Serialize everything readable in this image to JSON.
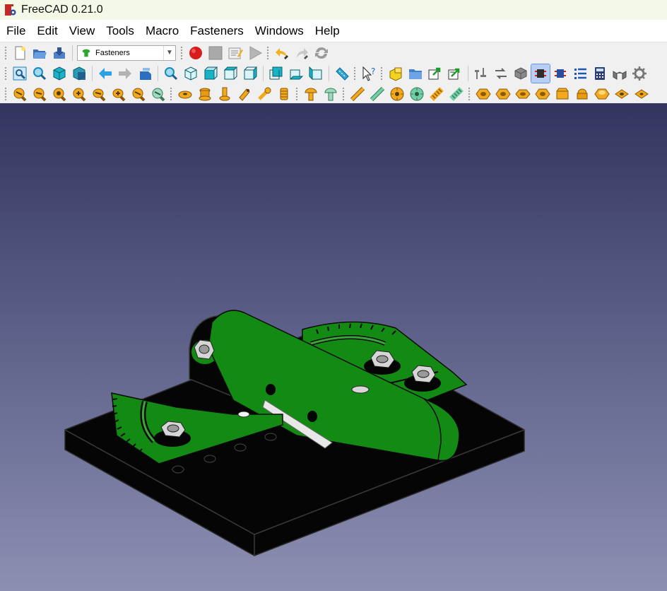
{
  "window": {
    "title": "FreeCAD 0.21.0",
    "logo_icon": "freecad-logo-icon"
  },
  "menu": {
    "items": [
      {
        "label": "File"
      },
      {
        "label": "Edit"
      },
      {
        "label": "View"
      },
      {
        "label": "Tools"
      },
      {
        "label": "Macro"
      },
      {
        "label": "Fasteners"
      },
      {
        "label": "Windows"
      },
      {
        "label": "Help"
      }
    ]
  },
  "workbench": {
    "selected": "Fasteners"
  },
  "colors": {
    "titlebar_bg": "#f4f8e6",
    "viewport_top": "#33345f",
    "viewport_bottom": "#8d8fb2",
    "model_green": "#138a13",
    "model_black": "#050505",
    "fastener_icon": "#f2a91e"
  },
  "toolbar_icons": {
    "row1": [
      "new-document-icon",
      "open-document-icon",
      "save-document-icon",
      "workbench-selector",
      "record-macro-icon",
      "stop-macro-icon",
      "edit-macro-icon",
      "run-macro-icon",
      "undo-icon",
      "redo-icon",
      "refresh-icon"
    ],
    "row2": [
      "fit-all-icon",
      "fit-selection-icon",
      "isometric-view-icon",
      "draw-style-icon",
      "back-view-icon",
      "forward-view-icon",
      "sync-view-icon",
      "zoom-icon",
      "axonometric-icon",
      "front-view-icon",
      "top-view-icon",
      "right-view-icon",
      "rear-view-icon",
      "bottom-view-icon",
      "left-view-icon",
      "measure-distance-icon",
      "whats-this-icon",
      "create-part-icon",
      "create-group-icon",
      "link-icon",
      "link-group-icon",
      "fastener-tools-icon",
      "flip-icon",
      "simplify-icon",
      "match-type-icon",
      "toggle-icon",
      "parts-list-icon",
      "calculator-icon",
      "thread-icon",
      "gear-icon"
    ],
    "row3": [
      "screw-icon-1",
      "screw-icon-2",
      "screw-icon-3",
      "screw-icon-4",
      "screw-icon-5",
      "screw-icon-6",
      "screw-icon-7",
      "screw-icon-8",
      "washer-icon-1",
      "nut-insert-icon",
      "pin-icon",
      "standoff-icon",
      "dowel-icon",
      "threaded-insert-icon",
      "rivet-icon-1",
      "rivet-icon-2",
      "rod-icon-1",
      "rod-icon-2",
      "pem-nut-icon",
      "pem-stud-icon",
      "thread-rod-icon-1",
      "thread-rod-icon-2",
      "hex-nut-icon-1",
      "hex-nut-icon-2",
      "hex-nut-icon-3",
      "hex-nut-icon-4",
      "hex-nut-icon-5",
      "cap-nut-icon",
      "hex-nut-icon-6",
      "square-nut-icon",
      "square-washer-icon"
    ]
  }
}
